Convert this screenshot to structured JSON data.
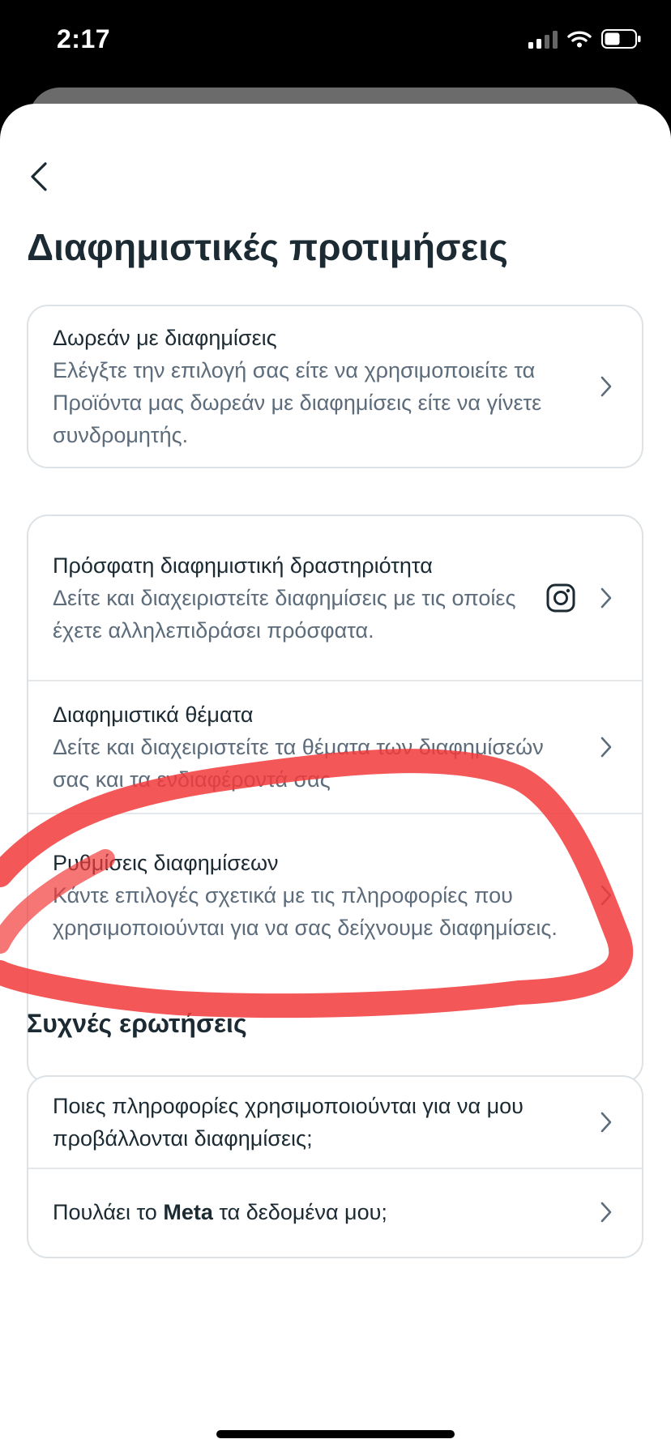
{
  "status_bar": {
    "time": "2:17",
    "signal_bars_active": 2,
    "signal_bars_total": 4,
    "battery_level": 0.5
  },
  "page": {
    "title": "Διαφημιστικές προτιμήσεις"
  },
  "ad_free": {
    "title": "Δωρεάν με διαφημίσεις",
    "desc": "Ελέγξτε την επιλογή σας είτε να χρησιμοποιείτε τα Προϊόντα μας δωρεάν με διαφημίσεις είτε να γίνετε συνδρομητής."
  },
  "activity_card": {
    "items": [
      {
        "title": "Πρόσφατη διαφημιστική δραστηριότητα",
        "desc": "Δείτε και διαχειριστείτε διαφημίσεις με τις οποίες έχετε αλληλεπιδράσει πρόσφατα.",
        "icon": "instagram-icon"
      },
      {
        "title": "Διαφημιστικά θέματα",
        "desc": "Δείτε και διαχειριστείτε τα θέματα των διαφημίσεών σας και τα ενδιαφέροντά σας"
      },
      {
        "title": "Ρυθμίσεις διαφημίσεων",
        "desc": "Κάντε επιλογές σχετικά με τις πληροφορίες που χρησιμοποιούνται για να σας δείχνουμε διαφημίσεις."
      }
    ]
  },
  "faq": {
    "title": "Συχνές ερωτήσεις",
    "items": [
      {
        "label": "Ποιες πληροφορίες χρησιμοποιούνται για να μου προβάλλονται διαφημίσεις;"
      },
      {
        "label_before": "Πουλάει το ",
        "label_bold": "Meta",
        "label_after": " τα δεδομένα μου;"
      }
    ]
  },
  "colors": {
    "annotation": "#f23a3a",
    "text_primary": "#1c2b33",
    "text_secondary": "#5d6c7b",
    "border": "#dde2e6"
  }
}
